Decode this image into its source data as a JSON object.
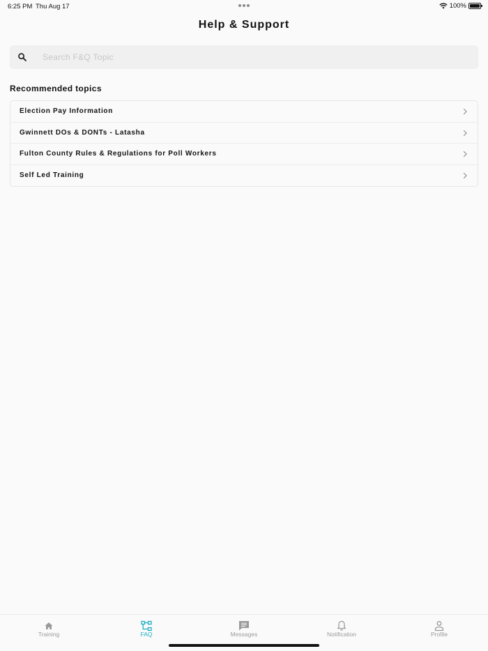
{
  "status_bar": {
    "time": "6:25 PM",
    "date": "Thu Aug 17",
    "battery": "100%",
    "battery_level": 1.0
  },
  "header": {
    "title": "Help & Support"
  },
  "search": {
    "placeholder": "Search F&Q Topic",
    "value": "",
    "icon": "search-icon"
  },
  "topics": {
    "section_title": "Recommended topics",
    "items": [
      {
        "label": "Election Pay Information"
      },
      {
        "label": "Gwinnett DOs & DONTs - Latasha"
      },
      {
        "label": "Fulton County Rules & Regulations for Poll Workers"
      },
      {
        "label": "Self Led Training"
      }
    ]
  },
  "tab_bar": {
    "active": "FAQ",
    "active_color": "#1ab0c4",
    "inactive_color": "#9a9a9a",
    "tabs": [
      {
        "label": "Training",
        "icon": "home-icon"
      },
      {
        "label": "FAQ",
        "icon": "sitemap-icon"
      },
      {
        "label": "Messages",
        "icon": "message-icon"
      },
      {
        "label": "Notification",
        "icon": "bell-icon"
      },
      {
        "label": "Profile",
        "icon": "user-icon"
      }
    ]
  }
}
